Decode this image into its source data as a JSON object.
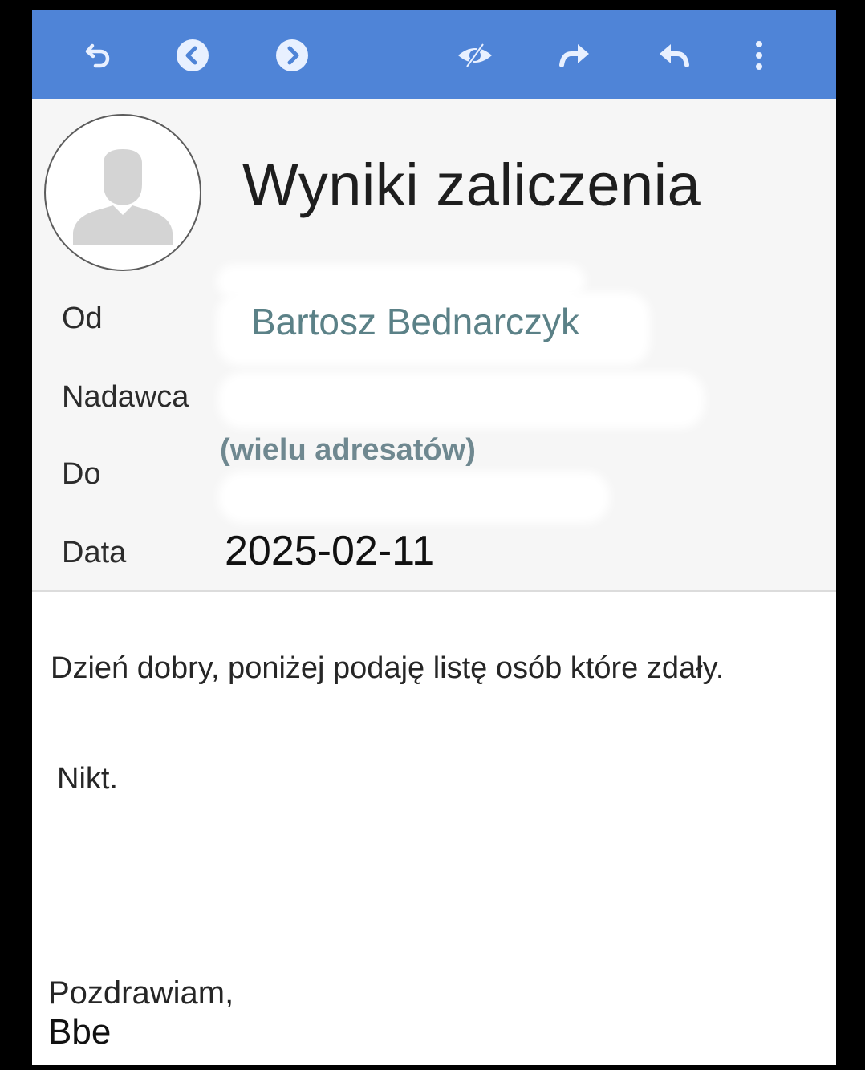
{
  "toolbar": {
    "background_color": "#4f84d7",
    "icons": [
      "undo-icon",
      "previous-icon",
      "next-icon",
      "hide-images-icon",
      "forward-icon",
      "reply-icon",
      "more-menu-icon"
    ]
  },
  "message": {
    "subject": "Wyniki zaliczenia",
    "fields": {
      "from_label": "Od",
      "from_value": "Bartosz Bednarczyk",
      "sender_label": "Nadawca",
      "to_label": "Do",
      "to_value": "(wielu adresatów)",
      "date_label": "Data",
      "date_value": "2025-02-11"
    },
    "body": {
      "greeting": "Dzień dobry, poniżej podaję listę osób które zdały.",
      "content": "Nikt.",
      "closing": "Pozdrawiam,",
      "signature": "Bbe"
    }
  },
  "colors": {
    "sender_link": "#5b8187",
    "header_background": "#f6f6f6"
  }
}
